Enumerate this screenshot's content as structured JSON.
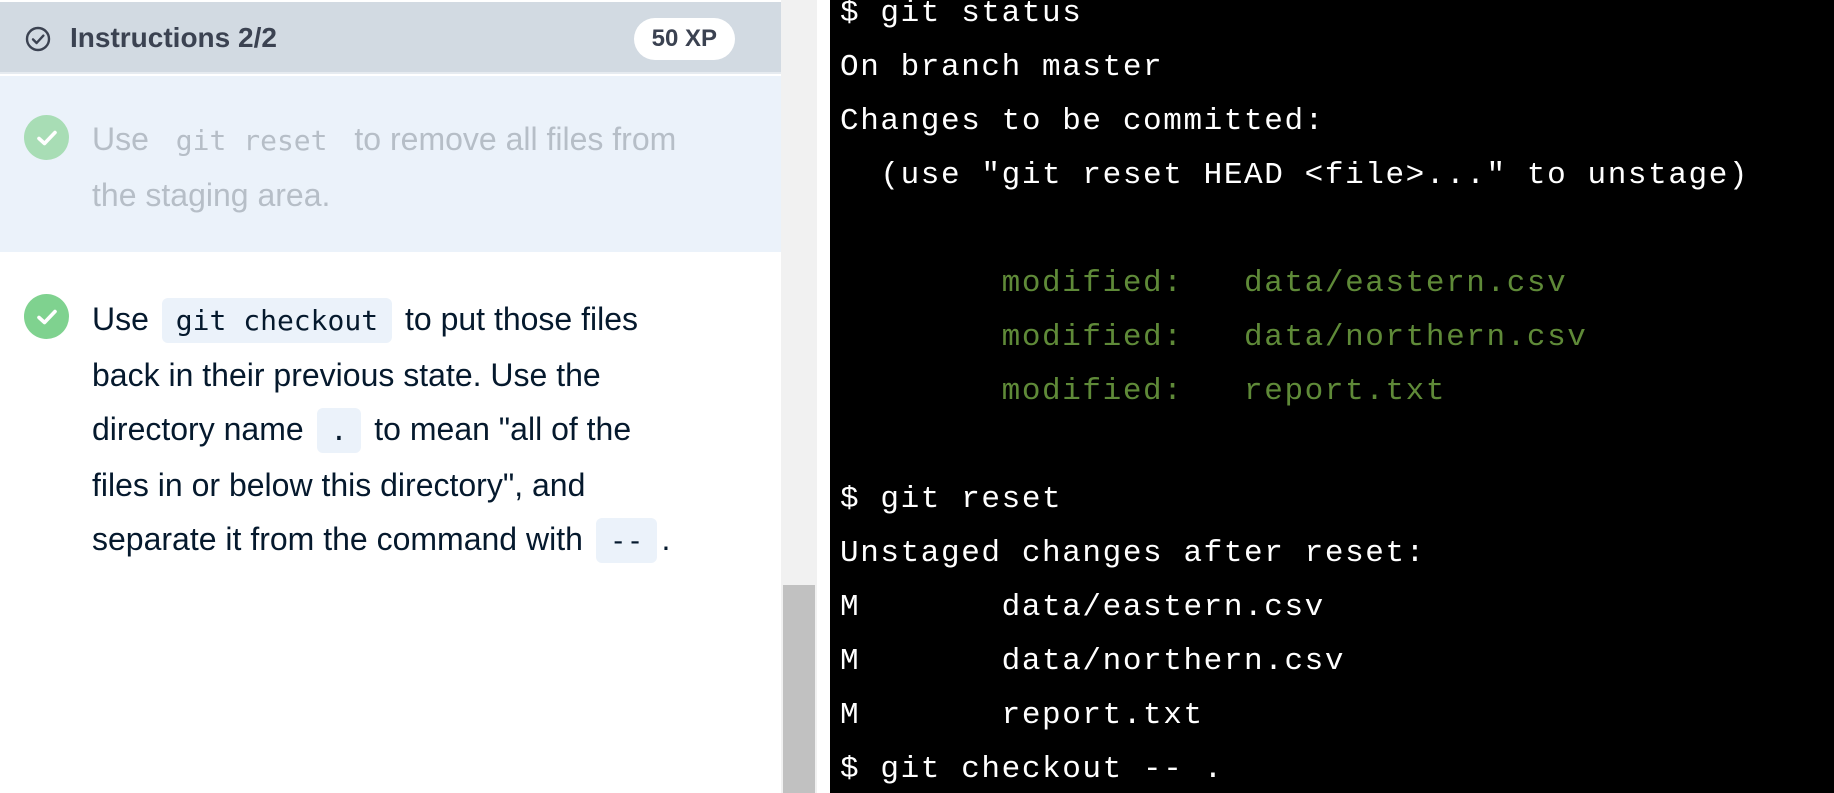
{
  "instructions": {
    "title": "Instructions 2/2",
    "xp": "50 XP",
    "steps": [
      {
        "status": "complete",
        "lines": [
          {
            "pre": "Use",
            "code": "git reset",
            "post": "to remove all files from"
          },
          {
            "text": "the staging area."
          }
        ]
      },
      {
        "status": "complete",
        "lines": [
          {
            "pre": "Use",
            "code": "git checkout",
            "post": "to put those files"
          },
          {
            "text": "back in their previous state. Use the"
          },
          {
            "pre": "directory name",
            "code": ".",
            "post": "to mean \"all of the"
          },
          {
            "text": "files in or below this directory\", and"
          },
          {
            "pre": "separate it from the command with",
            "code": "--",
            "post": "."
          }
        ]
      }
    ]
  },
  "terminal": {
    "lines": [
      {
        "text": "$ git status",
        "color": "white"
      },
      {
        "text": "On branch master",
        "color": "white"
      },
      {
        "text": "Changes to be committed:",
        "color": "white"
      },
      {
        "text": "  (use \"git reset HEAD <file>...\" to unstage)",
        "color": "white"
      },
      {
        "text": "",
        "color": "white"
      },
      {
        "text": "        modified:   data/eastern.csv",
        "color": "green"
      },
      {
        "text": "        modified:   data/northern.csv",
        "color": "green"
      },
      {
        "text": "        modified:   report.txt",
        "color": "green"
      },
      {
        "text": "",
        "color": "white"
      },
      {
        "text": "$ git reset",
        "color": "white"
      },
      {
        "text": "Unstaged changes after reset:",
        "color": "white"
      },
      {
        "text": "M       data/eastern.csv",
        "color": "white"
      },
      {
        "text": "M       data/northern.csv",
        "color": "white"
      },
      {
        "text": "M       report.txt",
        "color": "white"
      },
      {
        "text": "$ git checkout -- .",
        "color": "white"
      }
    ]
  },
  "colors": {
    "header_bg": "#d2dae2",
    "completed_step_bg": "#ebf2fa",
    "check_green": "#7fd28f",
    "terminal_bg": "#000000",
    "terminal_green": "#5f8a38"
  },
  "icons": {
    "header": "circle-check-icon",
    "step": "check-circle-icon"
  }
}
